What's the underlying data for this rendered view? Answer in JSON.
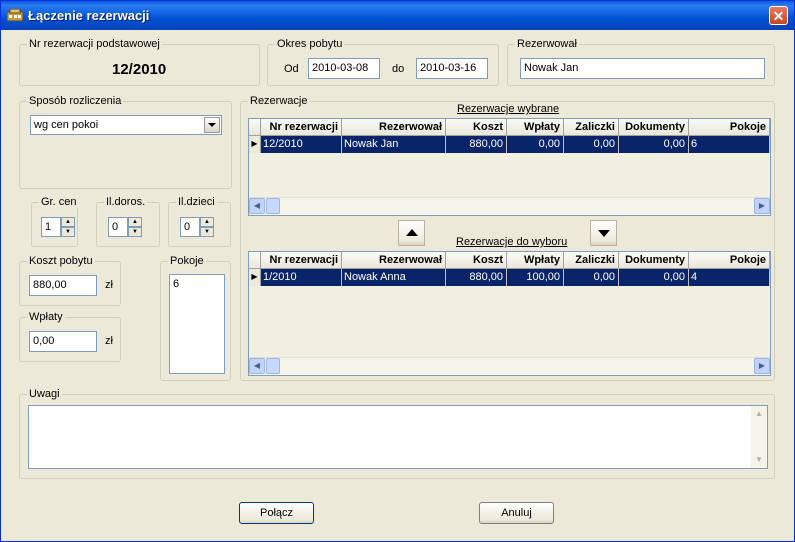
{
  "window": {
    "title": "Łączenie rezerwacji",
    "close_symbol": "✕"
  },
  "nr_rezerwacji": {
    "label": "Nr rezerwacji podstawowej",
    "value": "12/2010"
  },
  "okres": {
    "label": "Okres pobytu",
    "od_label": "Od",
    "od_value": "2010-03-08",
    "do_label": "do",
    "do_value": "2010-03-16"
  },
  "rezerwowal": {
    "label": "Rezerwował",
    "value": "Nowak Jan"
  },
  "sposob": {
    "label": "Sposób rozliczenia",
    "value": "wg cen pokoi"
  },
  "gr_cen": {
    "label": "Gr. cen",
    "value": "1"
  },
  "il_doros": {
    "label": "Il.doros.",
    "value": "0"
  },
  "il_dzieci": {
    "label": "Il.dzieci",
    "value": "0"
  },
  "koszt": {
    "label": "Koszt pobytu",
    "value": "880,00",
    "unit": "zł"
  },
  "wplaty": {
    "label": "Wpłaty",
    "value": "0,00",
    "unit": "zł"
  },
  "pokoje": {
    "label": "Pokoje",
    "value": "6"
  },
  "rezerwacje": {
    "label": "Rezerwacje",
    "columns": [
      "Nr rezerwacji",
      "Rezerwował",
      "Koszt",
      "Wpłaty",
      "Zaliczki",
      "Dokumenty",
      "Pokoje"
    ],
    "wybrane": {
      "label": "Rezerwacje wybrane",
      "rows": [
        [
          "12/2010",
          "Nowak Jan",
          "880,00",
          "0,00",
          "0,00",
          "0,00",
          "6"
        ]
      ]
    },
    "do_wyboru": {
      "label": "Rezerwacje do wyboru",
      "rows": [
        [
          "1/2010",
          "Nowak Anna",
          "880,00",
          "100,00",
          "0,00",
          "0,00",
          "4"
        ]
      ]
    }
  },
  "uwagi": {
    "label": "Uwagi",
    "value": ""
  },
  "buttons": {
    "polacz": "Połącz",
    "anuluj": "Anuluj"
  },
  "colors": {
    "titlebar": "#0052d6",
    "selection": "#0a246a",
    "dialog_bg": "#ece9d8"
  }
}
